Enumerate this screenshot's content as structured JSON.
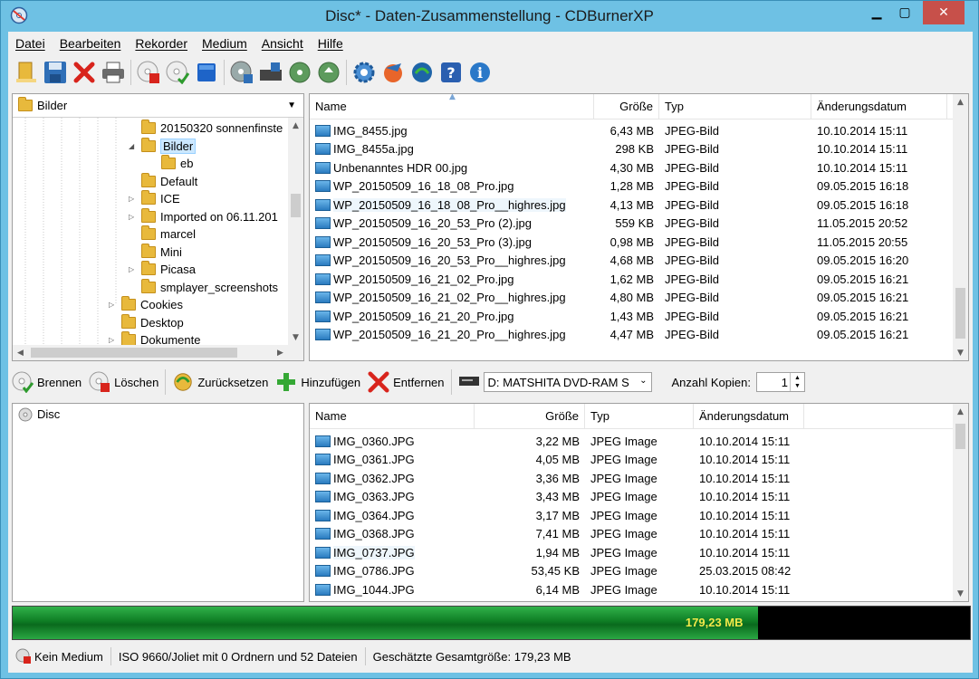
{
  "window": {
    "title": "Disc* - Daten-Zusammenstellung - CDBurnerXP"
  },
  "menu": [
    "Datei",
    "Bearbeiten",
    "Rekorder",
    "Medium",
    "Ansicht",
    "Hilfe"
  ],
  "toolbar_icons": [
    "new-compilation-icon",
    "save-icon",
    "close-icon",
    "print-icon",
    "erase-disc-icon",
    "burn-disc-icon",
    "blue-square-icon",
    "disc-info-icon",
    "drive-icon",
    "disc-copy-icon",
    "disc-refresh-icon",
    "settings-icon",
    "feedback-icon",
    "update-icon",
    "help-icon",
    "info-icon"
  ],
  "tree": {
    "combo_value": "Bilder",
    "items": [
      {
        "label": "20150320 sonnenfinste",
        "indent": 2,
        "expander": ""
      },
      {
        "label": "Bilder",
        "indent": 2,
        "expander": "◢",
        "selected": true
      },
      {
        "label": "eb",
        "indent": 3,
        "expander": ""
      },
      {
        "label": "Default",
        "indent": 2,
        "expander": ""
      },
      {
        "label": "ICE",
        "indent": 2,
        "expander": "▷"
      },
      {
        "label": "Imported on 06.11.201",
        "indent": 2,
        "expander": "▷"
      },
      {
        "label": "marcel",
        "indent": 2,
        "expander": ""
      },
      {
        "label": "Mini",
        "indent": 2,
        "expander": ""
      },
      {
        "label": "Picasa",
        "indent": 2,
        "expander": "▷"
      },
      {
        "label": "smplayer_screenshots",
        "indent": 2,
        "expander": ""
      },
      {
        "label": "Cookies",
        "indent": 1,
        "expander": "▷"
      },
      {
        "label": "Desktop",
        "indent": 1,
        "expander": ""
      },
      {
        "label": "Dokumente",
        "indent": 1,
        "expander": "▷"
      }
    ]
  },
  "source_list": {
    "columns": [
      "Name",
      "Größe",
      "Typ",
      "Änderungsdatum"
    ],
    "rows": [
      [
        "IMG_8455.jpg",
        "6,43 MB",
        "JPEG-Bild",
        "10.10.2014 15:11"
      ],
      [
        "IMG_8455a.jpg",
        "298 KB",
        "JPEG-Bild",
        "10.10.2014 15:11"
      ],
      [
        "Unbenanntes HDR 00.jpg",
        "4,30 MB",
        "JPEG-Bild",
        "10.10.2014 15:11"
      ],
      [
        "WP_20150509_16_18_08_Pro.jpg",
        "1,28 MB",
        "JPEG-Bild",
        "09.05.2015 16:18"
      ],
      [
        "WP_20150509_16_18_08_Pro__highres.jpg",
        "4,13 MB",
        "JPEG-Bild",
        "09.05.2015 16:18"
      ],
      [
        "WP_20150509_16_20_53_Pro (2).jpg",
        "559 KB",
        "JPEG-Bild",
        "11.05.2015 20:52"
      ],
      [
        "WP_20150509_16_20_53_Pro (3).jpg",
        "0,98 MB",
        "JPEG-Bild",
        "11.05.2015 20:55"
      ],
      [
        "WP_20150509_16_20_53_Pro__highres.jpg",
        "4,68 MB",
        "JPEG-Bild",
        "09.05.2015 16:20"
      ],
      [
        "WP_20150509_16_21_02_Pro.jpg",
        "1,62 MB",
        "JPEG-Bild",
        "09.05.2015 16:21"
      ],
      [
        "WP_20150509_16_21_02_Pro__highres.jpg",
        "4,80 MB",
        "JPEG-Bild",
        "09.05.2015 16:21"
      ],
      [
        "WP_20150509_16_21_20_Pro.jpg",
        "1,43 MB",
        "JPEG-Bild",
        "09.05.2015 16:21"
      ],
      [
        "WP_20150509_16_21_20_Pro__highres.jpg",
        "4,47 MB",
        "JPEG-Bild",
        "09.05.2015 16:21"
      ]
    ]
  },
  "actions": {
    "burn": "Brennen",
    "erase": "Löschen",
    "reset": "Zurücksetzen",
    "add": "Hinzufügen",
    "remove": "Entfernen",
    "drive": "D: MATSHITA DVD-RAM S",
    "copies_label": "Anzahl Kopien:",
    "copies_value": "1"
  },
  "disc_tree": {
    "root": "Disc"
  },
  "disc_list": {
    "columns": [
      "Name",
      "Größe",
      "Typ",
      "Änderungsdatum"
    ],
    "rows": [
      [
        "IMG_0360.JPG",
        "3,22 MB",
        "JPEG Image",
        "10.10.2014 15:11"
      ],
      [
        "IMG_0361.JPG",
        "4,05 MB",
        "JPEG Image",
        "10.10.2014 15:11"
      ],
      [
        "IMG_0362.JPG",
        "3,36 MB",
        "JPEG Image",
        "10.10.2014 15:11"
      ],
      [
        "IMG_0363.JPG",
        "3,43 MB",
        "JPEG Image",
        "10.10.2014 15:11"
      ],
      [
        "IMG_0364.JPG",
        "3,17 MB",
        "JPEG Image",
        "10.10.2014 15:11"
      ],
      [
        "IMG_0368.JPG",
        "7,41 MB",
        "JPEG Image",
        "10.10.2014 15:11"
      ],
      [
        "IMG_0737.JPG",
        "1,94 MB",
        "JPEG Image",
        "10.10.2014 15:11"
      ],
      [
        "IMG_0786.JPG",
        "53,45 KB",
        "JPEG Image",
        "25.03.2015 08:42"
      ],
      [
        "IMG_1044.JPG",
        "6,14 MB",
        "JPEG Image",
        "10.10.2014 15:11"
      ]
    ]
  },
  "usage": {
    "label": "179,23 MB",
    "fill_fraction": 0.779
  },
  "status": {
    "medium": "Kein Medium",
    "fs": "ISO 9660/Joliet mit 0 Ordnern und 52 Dateien",
    "size": "Geschätzte Gesamtgröße: 179,23 MB"
  },
  "colors": {
    "titlebar": "#6ec1e4",
    "close": "#c7504a",
    "usage_fill": "#0e7d24",
    "usage_label": "#f2e94a"
  }
}
